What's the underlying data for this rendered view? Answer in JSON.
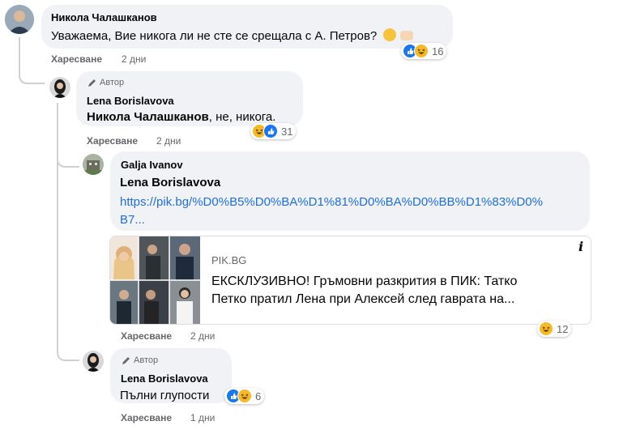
{
  "comments": [
    {
      "author": "Никола Чалашканов",
      "text": "Уважаема, Вие никога ли не сте се срещала с А. Петров?",
      "like_label": "Харесване",
      "time": "2 дни",
      "reactions": [
        "like",
        "haha"
      ],
      "reaction_count": "16"
    },
    {
      "author_tag": "Автор",
      "author": "Lena Borislavova",
      "mention": "Никола Чалашканов",
      "text": ", не, никога.",
      "like_label": "Харесване",
      "time": "2 дни",
      "reactions": [
        "haha",
        "like"
      ],
      "reaction_count": "31"
    },
    {
      "author": "Galja Ivanov",
      "mention": "Lena Borislavova",
      "link_line1": "https://pik.bg/%D0%B5%D0%BA%D1%81%D0%BA%D0%BB%D1%83%D0%",
      "link_line2": "B7...",
      "preview": {
        "domain": "PIK.BG",
        "title_line1": "ЕКСКЛУЗИВНО! Гръмовни разкрития в ПИК: Татко",
        "title_line2": "Петко пратил Лена при Алексей след гаврата на...",
        "info_icon": "i"
      },
      "like_label": "Харесване",
      "time": "2 дни",
      "reactions": [
        "haha"
      ],
      "reaction_count": "12"
    },
    {
      "author_tag": "Автор",
      "author": "Lena Borislavova",
      "text": "Пълни глупости",
      "like_label": "Харесване",
      "time": "1 дни",
      "reactions": [
        "like",
        "haha"
      ],
      "reaction_count": "6"
    }
  ],
  "colors": {
    "bubble": "#f0f2f5",
    "link": "#216fdb",
    "meta": "#65676b",
    "like": "#1877f2",
    "haha": "#f7b928"
  }
}
